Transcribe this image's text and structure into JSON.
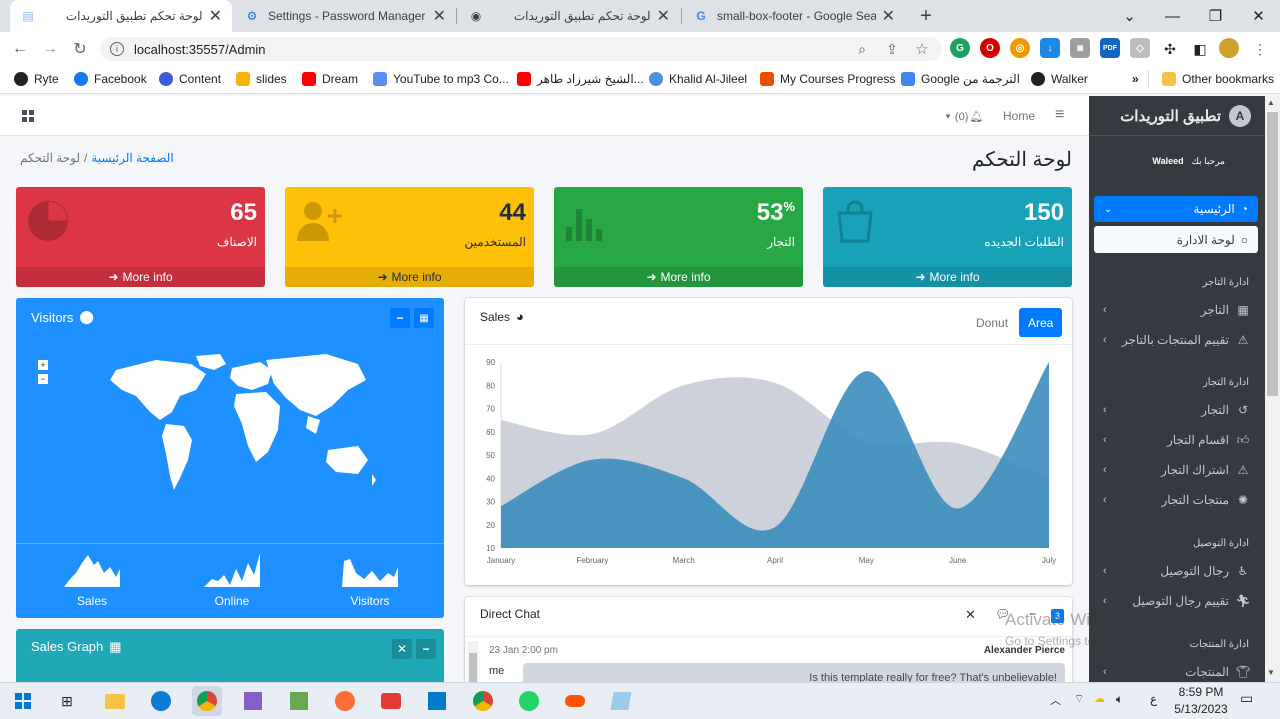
{
  "browser": {
    "tabs": [
      {
        "title": "لوحة تحكم تطبيق التوريدات",
        "active": true
      },
      {
        "title": "Settings - Password Manager",
        "active": false
      },
      {
        "title": "لوحة تحكم تطبيق التوريدات",
        "active": false
      },
      {
        "title": "small-box-footer - Google Search",
        "active": false
      }
    ],
    "url": "localhost:35557/Admin",
    "bookmarks": [
      "Ryte",
      "Facebook",
      "Content",
      "slides",
      "Dream",
      "YouTube to mp3 Co...",
      "الشيخ شيرزاد طاهر...",
      "Khalid Al-Jileel",
      "My Courses Progress",
      "Google الترجمة من",
      "Walker"
    ],
    "other_bookmarks": "Other bookmarks",
    "overflow": "»"
  },
  "topnav": {
    "notifications": "(0)",
    "home": "Home"
  },
  "sidebar": {
    "brand": "تطبيق التوريدات",
    "greeting": "مرحبا بك",
    "user": "Waleed",
    "main_item": "الرئيسية",
    "admin_panel": "لوحة الادارة",
    "sections": [
      {
        "header": "ادارة التاجر",
        "items": [
          "التاجر",
          "تقييم المنتجات بالتاجر"
        ]
      },
      {
        "header": "ادارة التجار",
        "items": [
          "التجار",
          "اقسام التجار",
          "اشتراك التجار",
          "منتجات التجار"
        ]
      },
      {
        "header": "ادارة التوصيل",
        "items": [
          "رجال التوصيل",
          "تقييم رجال التوصيل"
        ]
      },
      {
        "header": "ادارة المنتجات",
        "items": [
          "المنتجات"
        ]
      }
    ]
  },
  "page": {
    "title": "لوحة التحكم",
    "breadcrumb_home": "الصفحة الرئيسية",
    "breadcrumb_sep": "/",
    "breadcrumb_current": "لوحة التحكم"
  },
  "stats": [
    {
      "value": "150",
      "label": "الطلبات الجديده",
      "more": "More info",
      "color": "#17a2b8"
    },
    {
      "value": "53",
      "suffix": "%",
      "label": "التجار",
      "more": "More info",
      "color": "#28a745"
    },
    {
      "value": "44",
      "label": "المستخدمين",
      "more": "More info",
      "color": "#ffc107"
    },
    {
      "value": "65",
      "label": "الاصناف",
      "more": "More info",
      "color": "#dc3545"
    }
  ],
  "visitors": {
    "title": "Visitors",
    "sparks": [
      "Sales",
      "Online",
      "Visitors"
    ]
  },
  "sales": {
    "title": "Sales",
    "tab_donut": "Donut",
    "tab_area": "Area"
  },
  "chart_data": {
    "type": "area",
    "categories": [
      "January",
      "February",
      "March",
      "April",
      "May",
      "June",
      "July"
    ],
    "ylim": [
      10,
      90
    ],
    "yticks": [
      10,
      20,
      30,
      40,
      50,
      60,
      70,
      80,
      90
    ],
    "series": [
      {
        "values": [
          65,
          59,
          80,
          81,
          56,
          55,
          40
        ],
        "color": "#c8ccd6"
      },
      {
        "values": [
          28,
          48,
          40,
          19,
          86,
          27,
          90
        ],
        "color": "#3c8dbc"
      }
    ]
  },
  "sales_graph": {
    "title": "Sales Graph"
  },
  "chat": {
    "title": "Direct Chat",
    "badge": "3",
    "msg_time": "23 Jan 2:00 pm",
    "msg_author": "Alexander Pierce",
    "msg_text": "Is this template really for free? That's unbelievable!",
    "msg_img_alt": "me"
  },
  "watermark": {
    "line1": "Activate Windows",
    "line2": "Go to Settings to activate Windows."
  },
  "taskbar": {
    "time": "8:59 PM",
    "date": "5/13/2023",
    "lang": "ع"
  }
}
